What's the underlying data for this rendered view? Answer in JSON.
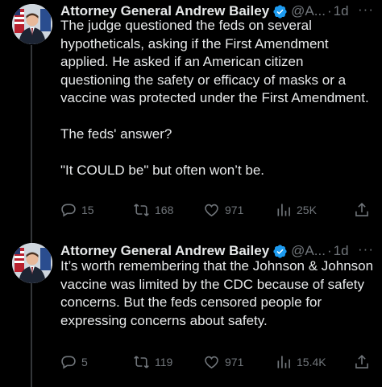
{
  "tweets": [
    {
      "author_name": "Attorney General Andrew Bailey",
      "handle": "@A...",
      "dot": "·",
      "time": "1d",
      "more": "···",
      "paragraphs": [
        "The judge questioned the feds on several hypotheticals, asking if the First Amendment applied. He asked if an American citizen questioning the safety or efficacy of masks or a vaccine was protected under the First Amendment.",
        "The feds' answer?",
        "\"It COULD be\" but often won’t be."
      ],
      "replies": "15",
      "reposts": "168",
      "likes": "971",
      "views": "25K"
    },
    {
      "author_name": "Attorney General Andrew Bailey",
      "handle": "@A...",
      "dot": "·",
      "time": "1d",
      "more": "···",
      "paragraphs": [
        "It’s worth remembering that the Johnson & Johnson vaccine was limited by the CDC because of safety concerns. But the feds censored people for expressing concerns about safety."
      ],
      "replies": "5",
      "reposts": "119",
      "likes": "971",
      "views": "15.4K"
    }
  ],
  "icons": {
    "reply": "reply-icon",
    "repost": "repost-icon",
    "like": "like-icon",
    "views": "views-icon",
    "share": "share-icon",
    "verified": "verified-badge-icon"
  },
  "colors": {
    "background": "#000000",
    "text": "#e7e9ea",
    "muted": "#71767b",
    "verified": "#1d9bf0"
  }
}
